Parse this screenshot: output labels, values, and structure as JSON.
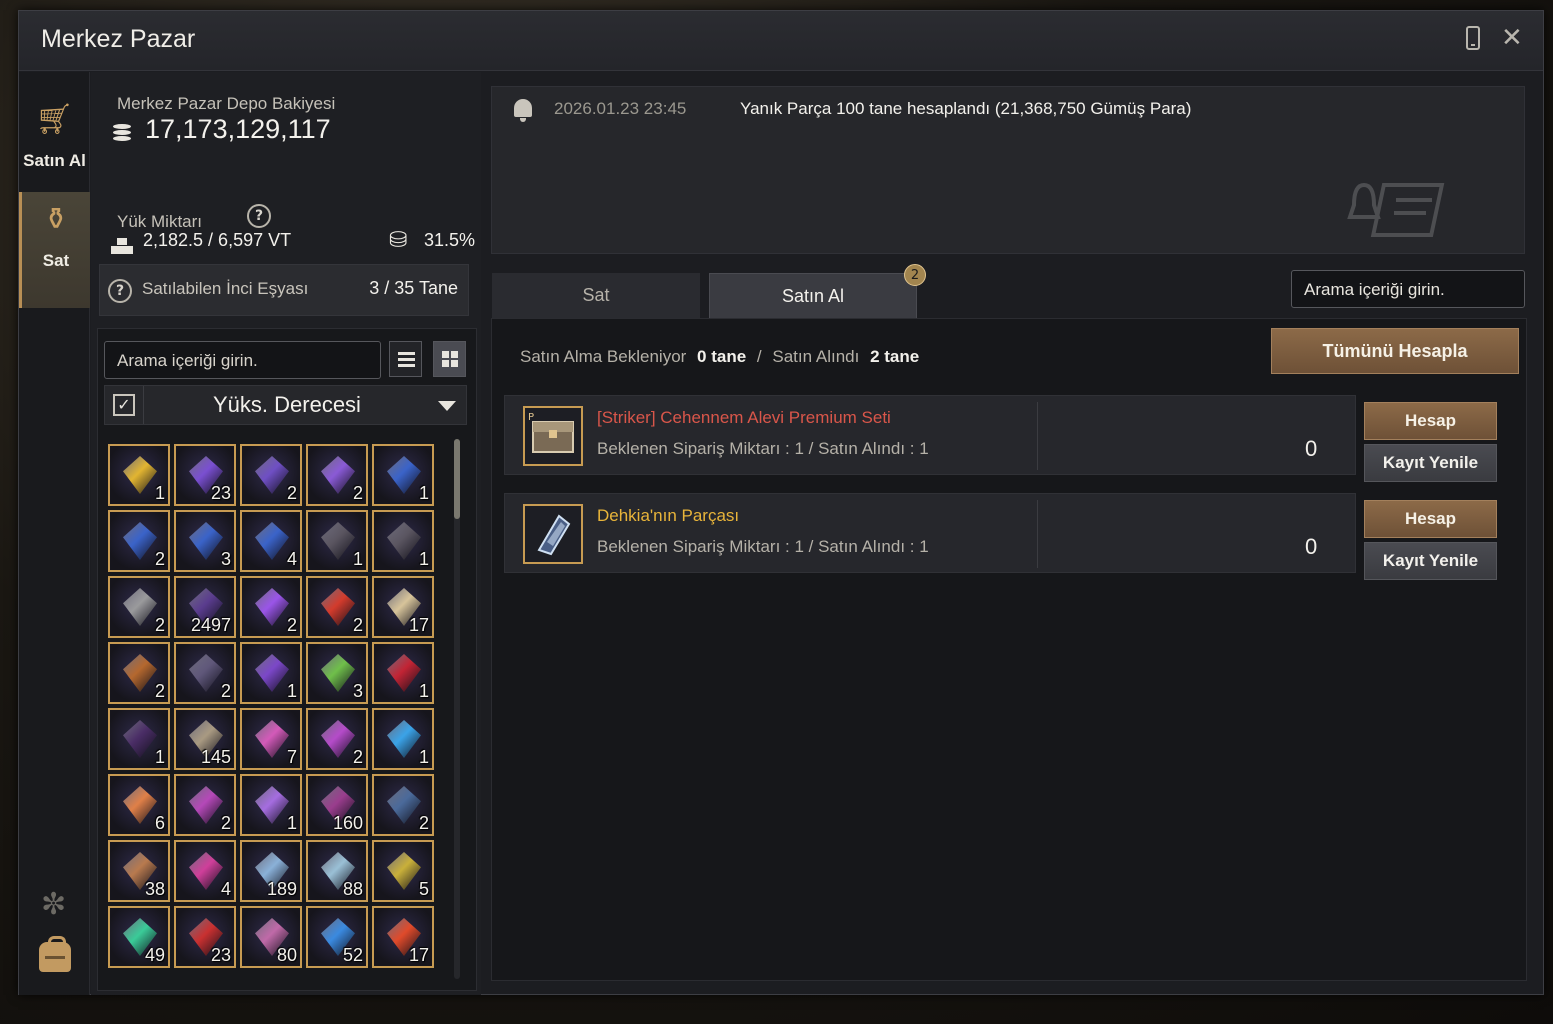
{
  "window": {
    "title": "Merkez Pazar"
  },
  "nav": {
    "buy_label": "Satın Al",
    "sell_label": "Sat"
  },
  "balance": {
    "label": "Merkez Pazar Depo Bakiyesi",
    "value": "17,173,129,117"
  },
  "load": {
    "label": "Yük Miktarı",
    "value": "2,182.5 / 6,597 VT",
    "percent": "31.5%"
  },
  "pearl": {
    "label": "Satılabilen İnci Eşyası",
    "value": "3 / 35 Tane"
  },
  "inventory": {
    "search_placeholder": "Arama içeriği girin.",
    "sort_label": "Yüks. Derecesi",
    "sort_checked": true,
    "items": [
      {
        "count": "1",
        "color": "#e2b531"
      },
      {
        "count": "23",
        "color": "#7a4fd1"
      },
      {
        "count": "2",
        "color": "#6f4fc4"
      },
      {
        "count": "2",
        "color": "#8a5ad6"
      },
      {
        "count": "1",
        "color": "#3a63c9"
      },
      {
        "count": "2",
        "color": "#3a63c9"
      },
      {
        "count": "3",
        "color": "#3a63c9"
      },
      {
        "count": "4",
        "color": "#3a63c9"
      },
      {
        "count": "1",
        "color": "#5a5560"
      },
      {
        "count": "1",
        "color": "#5a5560"
      },
      {
        "count": "2",
        "color": "#9a9a9c"
      },
      {
        "count": "2497",
        "color": "#5a3c8e"
      },
      {
        "count": "2",
        "color": "#9a55e8"
      },
      {
        "count": "2",
        "color": "#d33b2c"
      },
      {
        "count": "17",
        "color": "#d7c49a"
      },
      {
        "count": "2",
        "color": "#b5682e"
      },
      {
        "count": "2",
        "color": "#5f577a"
      },
      {
        "count": "1",
        "color": "#7b47c8"
      },
      {
        "count": "3",
        "color": "#6fbf4a"
      },
      {
        "count": "1",
        "color": "#c22434"
      },
      {
        "count": "1",
        "color": "#4a2d66"
      },
      {
        "count": "145",
        "color": "#a99a82"
      },
      {
        "count": "7",
        "color": "#d35ab9"
      },
      {
        "count": "2",
        "color": "#b54bc9"
      },
      {
        "count": "1",
        "color": "#3aa3e8"
      },
      {
        "count": "6",
        "color": "#e08048"
      },
      {
        "count": "2",
        "color": "#b548b8"
      },
      {
        "count": "1",
        "color": "#a56de0"
      },
      {
        "count": "160",
        "color": "#9a3d8d"
      },
      {
        "count": "2",
        "color": "#4a6a9a"
      },
      {
        "count": "38",
        "color": "#b87a4e"
      },
      {
        "count": "4",
        "color": "#cf3f9a"
      },
      {
        "count": "189",
        "color": "#8ab1d8"
      },
      {
        "count": "88",
        "color": "#9ac0d6"
      },
      {
        "count": "5",
        "color": "#c9b03a"
      },
      {
        "count": "49",
        "color": "#3acb98"
      },
      {
        "count": "23",
        "color": "#c93030"
      },
      {
        "count": "80",
        "color": "#c06aa8"
      },
      {
        "count": "52",
        "color": "#3a8ae0"
      },
      {
        "count": "17",
        "color": "#e04a2a"
      }
    ]
  },
  "notification": {
    "time": "2026.01.23 23:45",
    "message": "Yanık Parça 100 tane hesaplandı (21,368,750 Gümüş Para)"
  },
  "tabs": {
    "sell": "Sat",
    "buy": "Satın Al",
    "buy_badge": "2"
  },
  "right_search_placeholder": "Arama içeriği girin.",
  "status": {
    "pending_label": "Satın Alma Bekleniyor",
    "pending_value": "0 tane",
    "separator": "/",
    "done_label": "Satın Alındı",
    "done_value": "2 tane"
  },
  "settle_all_label": "Tümünü Hesapla",
  "orders": [
    {
      "name": "[Striker] Cehennem Alevi Premium Seti",
      "name_color": "#d9564a",
      "detail": "Beklenen Sipariş Miktarı : 1 / Satın Alındı : 1",
      "amount": "0",
      "settle_label": "Hesap",
      "renew_label": "Kayıt Yenile"
    },
    {
      "name": "Dehkia'nın Parçası",
      "name_color": "#e8b43a",
      "detail": "Beklenen Sipariş Miktarı : 1 / Satın Alındı : 1",
      "amount": "0",
      "settle_label": "Hesap",
      "renew_label": "Kayıt Yenile"
    }
  ]
}
